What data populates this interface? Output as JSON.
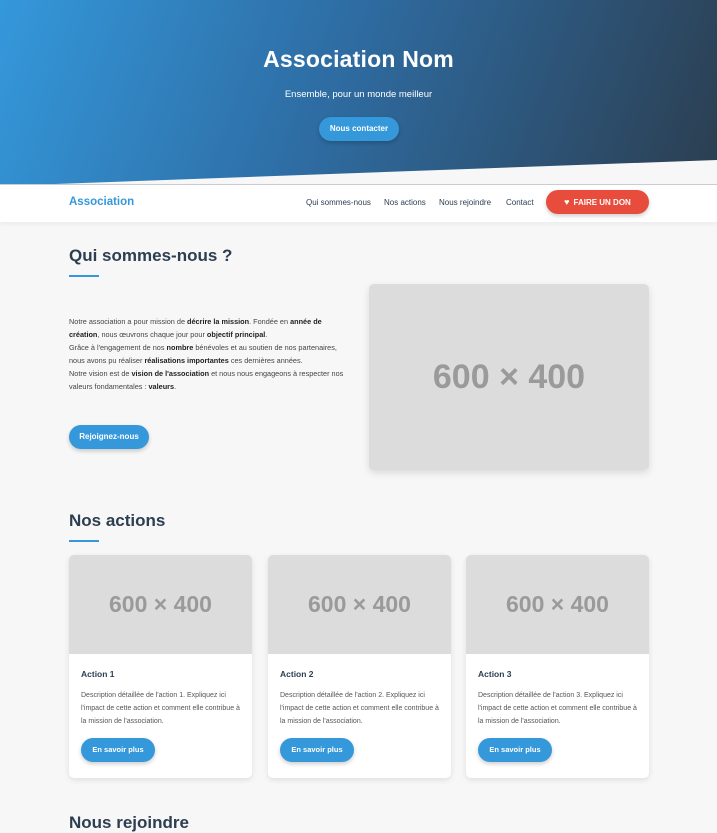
{
  "hero": {
    "title": "Association Nom",
    "tagline": "Ensemble, pour un monde meilleur",
    "contact_button": "Nous contacter"
  },
  "nav": {
    "brand": "Association",
    "links": [
      "Qui sommes-nous",
      "Nos actions",
      "Nous rejoindre",
      "Contact"
    ],
    "donate_button": "FAIRE UN DON",
    "donate_icon": "heart-icon"
  },
  "about": {
    "title": "Qui sommes-nous ?",
    "p1_a": "Notre association a pour mission de ",
    "p1_b": "décrire la mission",
    "p1_c": ". Fondée en ",
    "p1_d": "année de création",
    "p1_e": ", nous œuvrons chaque jour pour ",
    "p1_f": "objectif principal",
    "p1_g": ".",
    "p2_a": "Grâce à l'engagement de nos ",
    "p2_b": "nombre",
    "p2_c": " bénévoles et au soutien de nos partenaires, nous avons pu réaliser ",
    "p2_d": "réalisations importantes",
    "p2_e": " ces dernières années.",
    "p3_a": "Notre vision est de ",
    "p3_b": "vision de l'association",
    "p3_c": " et nous nous engageons à respecter nos valeurs fondamentales : ",
    "p3_d": "valeurs",
    "p3_e": ".",
    "join_button": "Rejoignez-nous",
    "image_placeholder": "600 × 400"
  },
  "actions": {
    "title": "Nos actions",
    "cards": [
      {
        "image_placeholder": "600 × 400",
        "title": "Action 1",
        "description": "Description détaillée de l'action 1. Expliquez ici l'impact de cette action et comment elle contribue à la mission de l'association.",
        "button": "En savoir plus"
      },
      {
        "image_placeholder": "600 × 400",
        "title": "Action 2",
        "description": "Description détaillée de l'action 2. Expliquez ici l'impact de cette action et comment elle contribue à la mission de l'association.",
        "button": "En savoir plus"
      },
      {
        "image_placeholder": "600 × 400",
        "title": "Action 3",
        "description": "Description détaillée de l'action 3. Expliquez ici l'impact de cette action et comment elle contribue à la mission de l'association.",
        "button": "En savoir plus"
      }
    ]
  },
  "join": {
    "title": "Nous rejoindre"
  },
  "colors": {
    "primary": "#3498db",
    "dark": "#2c3e50",
    "donate": "#e74c3c",
    "background": "#f7f7f7",
    "placeholder": "#dcdcdc"
  }
}
